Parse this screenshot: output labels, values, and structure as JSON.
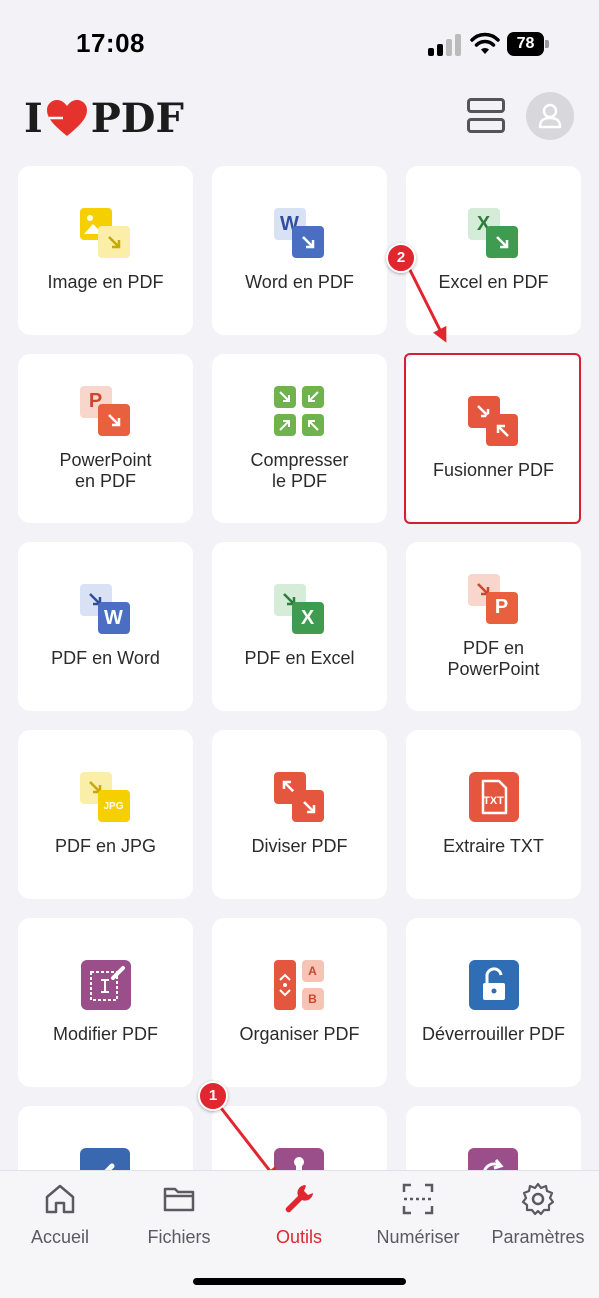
{
  "status_bar": {
    "time": "17:08",
    "battery": "78"
  },
  "header": {
    "logo_left": "I",
    "logo_right": "PDF"
  },
  "tools": [
    {
      "label": "Image en PDF",
      "icon": "image-to-pdf-icon"
    },
    {
      "label": "Word en PDF",
      "icon": "word-to-pdf-icon"
    },
    {
      "label": "Excel en PDF",
      "icon": "excel-to-pdf-icon"
    },
    {
      "label": "PowerPoint\nen PDF",
      "icon": "powerpoint-to-pdf-icon"
    },
    {
      "label": "Compresser\nle PDF",
      "icon": "compress-pdf-icon"
    },
    {
      "label": "Fusionner PDF",
      "icon": "merge-pdf-icon"
    },
    {
      "label": "PDF en Word",
      "icon": "pdf-to-word-icon"
    },
    {
      "label": "PDF en Excel",
      "icon": "pdf-to-excel-icon"
    },
    {
      "label": "PDF en\nPowerPoint",
      "icon": "pdf-to-powerpoint-icon"
    },
    {
      "label": "PDF en JPG",
      "icon": "pdf-to-jpg-icon"
    },
    {
      "label": "Diviser PDF",
      "icon": "split-pdf-icon"
    },
    {
      "label": "Extraire TXT",
      "icon": "extract-txt-icon"
    },
    {
      "label": "Modifier PDF",
      "icon": "edit-pdf-icon"
    },
    {
      "label": "Organiser PDF",
      "icon": "organize-pdf-icon"
    },
    {
      "label": "Déverrouiller PDF",
      "icon": "unlock-pdf-icon"
    }
  ],
  "icon_text": {
    "word": "W",
    "excel": "X",
    "ppt": "P",
    "jpg": "JPG",
    "txt": "TXT",
    "a": "A",
    "b": "B"
  },
  "annotations": {
    "badge_1": "1",
    "badge_2": "2"
  },
  "tabs": [
    {
      "label": "Accueil",
      "icon": "home-icon"
    },
    {
      "label": "Fichiers",
      "icon": "folder-icon"
    },
    {
      "label": "Outils",
      "icon": "wrench-icon",
      "active": true
    },
    {
      "label": "Numériser",
      "icon": "scan-icon"
    },
    {
      "label": "Paramètres",
      "icon": "gear-icon"
    }
  ],
  "colors": {
    "accent": "#e0262f",
    "pdf_red": "#e5563f",
    "word_blue": "#4a6fc2",
    "excel_green": "#3f9b4f",
    "ppt_orange": "#e8603e",
    "jpg_yellow": "#f5cf00",
    "edit_purple": "#9a4f8a",
    "lock_blue": "#2f6db5"
  }
}
